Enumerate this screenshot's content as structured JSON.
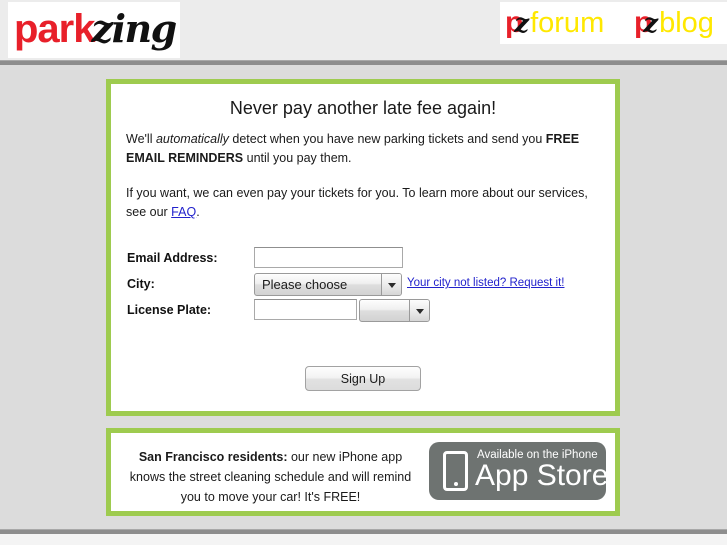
{
  "header": {
    "logo": {
      "part1": "park",
      "part2": "zing"
    },
    "nav": [
      {
        "name": "pz-forum",
        "p": "p",
        "z": "z",
        "word": "forum"
      },
      {
        "name": "pz-blog",
        "p": "p",
        "z": "z",
        "word": "blog"
      }
    ]
  },
  "signup": {
    "headline": "Never pay another late fee again!",
    "copy1": {
      "a": "We'll ",
      "italic": "automatically",
      "b": " detect when you have new parking tickets and send you ",
      "bold": "FREE EMAIL REMINDERS",
      "c": " until you pay them."
    },
    "copy2": {
      "a": "If you want, we can even pay your tickets for you. To learn more about our services, see our ",
      "link": "FAQ",
      "b": "."
    },
    "fields": {
      "email_label": "Email Address:",
      "email_value": "",
      "email_placeholder": "",
      "city_label": "City:",
      "city_value": "Please choose",
      "city_request_link": "Your city not listed? Request it!",
      "plate_label": "License Plate:",
      "plate_value": "",
      "plate_placeholder": "",
      "state_value": ""
    },
    "submit_label": "Sign Up"
  },
  "app_promo": {
    "bold_lead": "San Francisco residents:",
    "text": " our new iPhone app knows the street cleaning schedule and will remind you to move your car! It's FREE!",
    "badge": {
      "top": "Available on the iPhone",
      "main": "App Store"
    }
  },
  "colors": {
    "brand_red": "#e8202a",
    "brand_yellow": "#ffe800",
    "panel_green": "#9ecb4f",
    "page_background": "#dcdcdc",
    "link_blue": "#2222cc",
    "badge_gray": "#6e7371"
  }
}
